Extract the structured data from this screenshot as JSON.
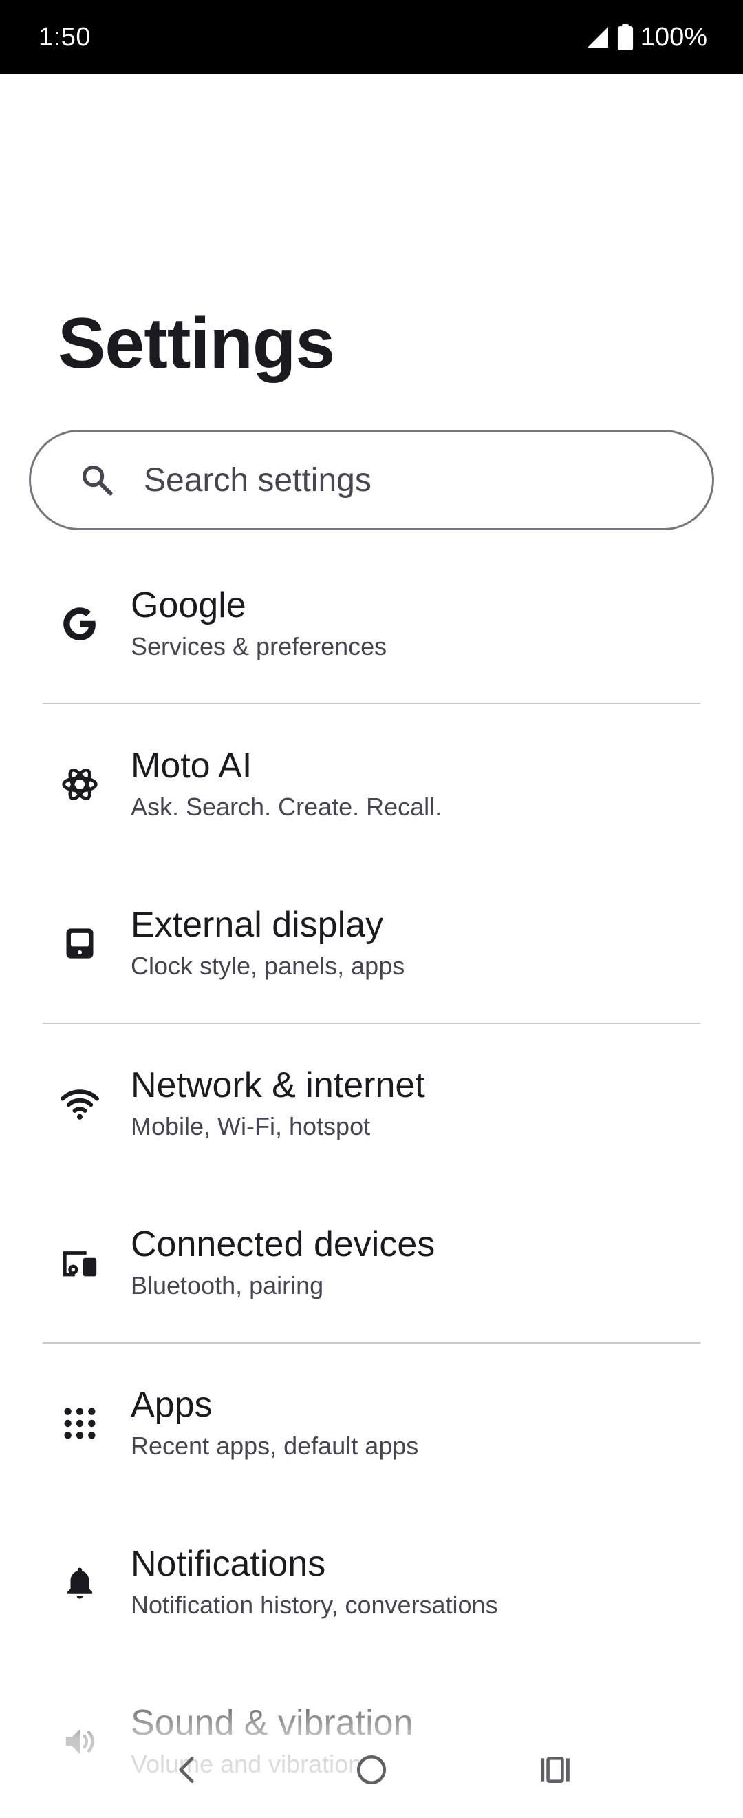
{
  "status_bar": {
    "time": "1:50",
    "battery": "100%"
  },
  "page": {
    "title": "Settings"
  },
  "search": {
    "placeholder": "Search settings"
  },
  "items": [
    {
      "title": "Google",
      "subtitle": "Services & preferences",
      "icon": "google-g-icon"
    },
    {
      "title": "Moto AI",
      "subtitle": "Ask. Search. Create. Recall.",
      "icon": "moto-ai-icon"
    },
    {
      "title": "External display",
      "subtitle": "Clock style, panels, apps",
      "icon": "external-display-icon"
    },
    {
      "title": "Network & internet",
      "subtitle": "Mobile, Wi-Fi, hotspot",
      "icon": "wifi-icon"
    },
    {
      "title": "Connected devices",
      "subtitle": "Bluetooth, pairing",
      "icon": "connected-devices-icon"
    },
    {
      "title": "Apps",
      "subtitle": "Recent apps, default apps",
      "icon": "apps-grid-icon"
    },
    {
      "title": "Notifications",
      "subtitle": "Notification history, conversations",
      "icon": "bell-icon"
    },
    {
      "title": "Sound & vibration",
      "subtitle": "Volume and vibration",
      "icon": "volume-icon"
    }
  ],
  "colors": {
    "text_primary": "#1b1b1f",
    "text_secondary": "#45464f",
    "divider": "#c7c7cf",
    "outline": "#75757d"
  }
}
